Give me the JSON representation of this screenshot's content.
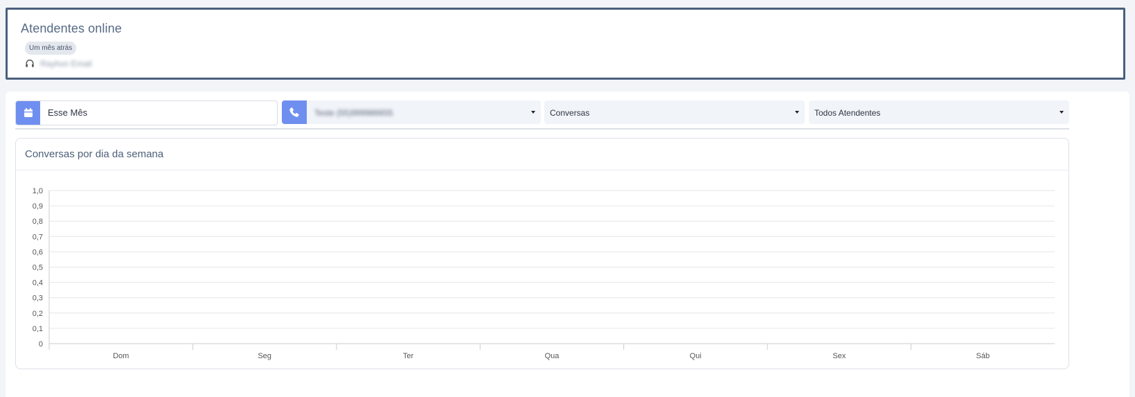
{
  "online_card": {
    "title": "Atendentes online",
    "time_badge": "Um mês atrás",
    "agent_name": "Rayhon Email",
    "agent_icon": "headset-icon"
  },
  "filters": {
    "date_range": {
      "value": "Esse Mês",
      "icon": "calendar-icon"
    },
    "phone": {
      "value": "Teste (55)999986655",
      "icon": "phone-icon"
    },
    "metric": {
      "value": "Conversas"
    },
    "agents": {
      "value": "Todos Atendentes"
    }
  },
  "colors": {
    "accent": "#6f8ff0",
    "card_border": "#4b5f7c",
    "title": "#566a85",
    "background": "#f2f4f8"
  },
  "chart_data": {
    "type": "bar",
    "title": "Conversas por dia da semana",
    "categories": [
      "Dom",
      "Seg",
      "Ter",
      "Qua",
      "Qui",
      "Sex",
      "Sáb"
    ],
    "values": [
      0,
      0,
      0,
      0,
      0,
      0,
      0
    ],
    "y_ticks": [
      "0",
      "0,1",
      "0,2",
      "0,3",
      "0,4",
      "0,5",
      "0,6",
      "0,7",
      "0,8",
      "0,9",
      "1,0"
    ],
    "ylim": [
      0,
      1
    ],
    "grid": true,
    "xlabel": "",
    "ylabel": ""
  }
}
